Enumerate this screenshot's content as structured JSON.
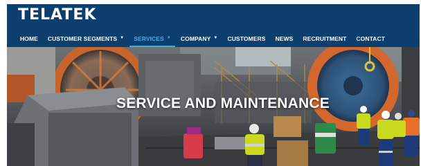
{
  "header": {
    "logo_text": "TELATEK",
    "background_color": "#0d3f6e",
    "accent_color": "#3fb0e6"
  },
  "nav": {
    "items": [
      {
        "label": "HOME",
        "dropdown": false,
        "active": false
      },
      {
        "label": "CUSTOMER SEGMENTS",
        "dropdown": true,
        "active": false
      },
      {
        "label": "SERVICES",
        "dropdown": true,
        "active": true
      },
      {
        "label": "COMPANY",
        "dropdown": true,
        "active": false
      },
      {
        "label": "CUSTOMERS",
        "dropdown": false,
        "active": false
      },
      {
        "label": "NEWS",
        "dropdown": false,
        "active": false
      },
      {
        "label": "RECRUITMENT",
        "dropdown": false,
        "active": false
      },
      {
        "label": "CONTACT",
        "dropdown": false,
        "active": false
      }
    ],
    "dropdown_icon": "caret-down-icon"
  },
  "hero": {
    "title": "SERVICE AND MAINTENANCE"
  }
}
